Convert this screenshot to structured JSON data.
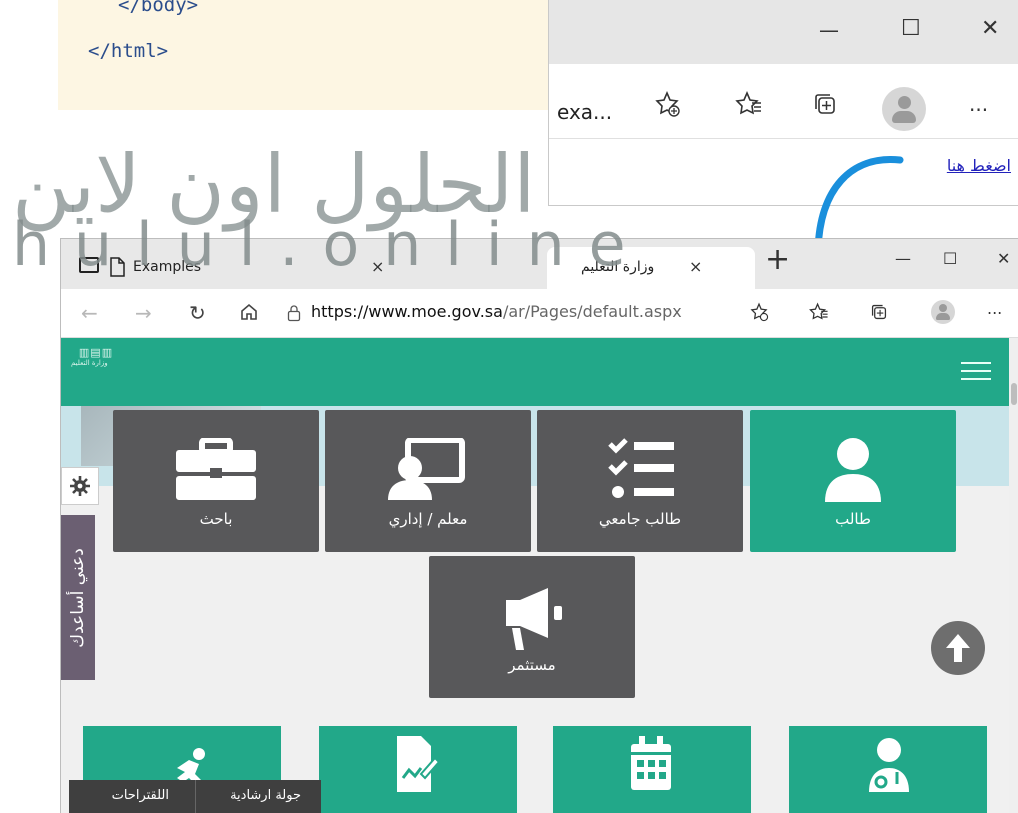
{
  "code_snippet": {
    "line1": "</body>",
    "line2": "</html>"
  },
  "watermark": {
    "arabic_text": "الحلول اون لاين",
    "latin_text": "hulul.online"
  },
  "inset_browser": {
    "title_controls": {
      "minimize": "—",
      "maximize": "☐",
      "close": "✕"
    },
    "address_fragment": "exa...",
    "link_text": "اضغط هنا",
    "toolbar_more": "..."
  },
  "browser": {
    "tabs": [
      {
        "label": "Examples",
        "close": "×"
      },
      {
        "label": "وزارة التعليم",
        "close": "×"
      }
    ],
    "new_tab": "+",
    "window_controls": {
      "minimize": "—",
      "maximize": "☐",
      "close": "✕"
    },
    "url_host": "https://www.moe.gov.sa",
    "url_path": "/ar/Pages/default.aspx",
    "more_menu": "..."
  },
  "site": {
    "logo_text": "وزارة التعليم",
    "accent_color": "#22a889",
    "tile_dark_color": "#58585a",
    "tiles_row1": [
      {
        "label": "باحث",
        "icon": "briefcase-icon"
      },
      {
        "label": "معلم / إداري",
        "icon": "teacher-board-icon"
      },
      {
        "label": "طالب جامعي",
        "icon": "checklist-icon"
      },
      {
        "label": "طالب",
        "icon": "user-icon"
      }
    ],
    "tile_row2": {
      "label": "مستثمر",
      "icon": "megaphone-icon"
    },
    "side_tab_label": "دعني أساعدك",
    "bottom_tiles": [
      {
        "icon": "runner-icon"
      },
      {
        "icon": "document-edit-icon"
      },
      {
        "icon": "calendar-icon"
      },
      {
        "icon": "doctor-icon"
      }
    ],
    "bottom_bar": {
      "suggestions": "اللقتراحات",
      "guided_tour": "جولة ارشادية"
    }
  }
}
